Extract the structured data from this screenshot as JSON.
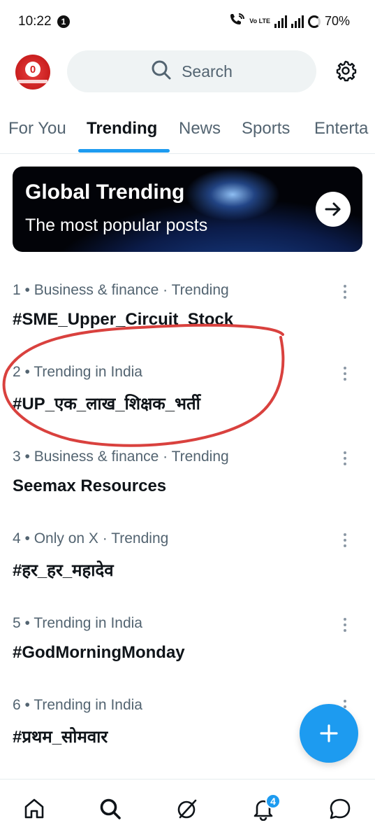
{
  "status_bar": {
    "time": "10:22",
    "notification_count": "1",
    "network_label": "Vo LTE",
    "battery": "70%"
  },
  "header": {
    "avatar_badge": "0",
    "search_placeholder": "Search"
  },
  "tabs": [
    {
      "label": "For You",
      "active": false
    },
    {
      "label": "Trending",
      "active": true
    },
    {
      "label": "News",
      "active": false
    },
    {
      "label": "Sports",
      "active": false
    },
    {
      "label": "Enterta",
      "active": false
    }
  ],
  "banner": {
    "title": "Global Trending",
    "subtitle": "The most popular posts"
  },
  "trends": [
    {
      "meta": "1 • Business & finance · Trending",
      "topic": "#SME_Upper_Circuit_Stock"
    },
    {
      "meta": "2 • Trending in India",
      "topic": "#UP_एक_लाख_शिक्षक_भर्ती"
    },
    {
      "meta": "3 • Business & finance · Trending",
      "topic": "Seemax Resources"
    },
    {
      "meta": "4 • Only on X · Trending",
      "topic": "#हर_हर_महादेव"
    },
    {
      "meta": "5 • Trending in India",
      "topic": "#GodMorningMonday"
    },
    {
      "meta": "6 • Trending in India",
      "topic": "#प्रथम_सोमवार"
    }
  ],
  "bottom_nav": {
    "items": [
      "home-icon",
      "search-icon",
      "grok-icon",
      "bell-icon",
      "messages-icon"
    ],
    "notification_badge": "4"
  },
  "colors": {
    "accent": "#1d9bf0",
    "text_primary": "#0f1419",
    "text_secondary": "#536471",
    "annotation": "#d9413e"
  }
}
